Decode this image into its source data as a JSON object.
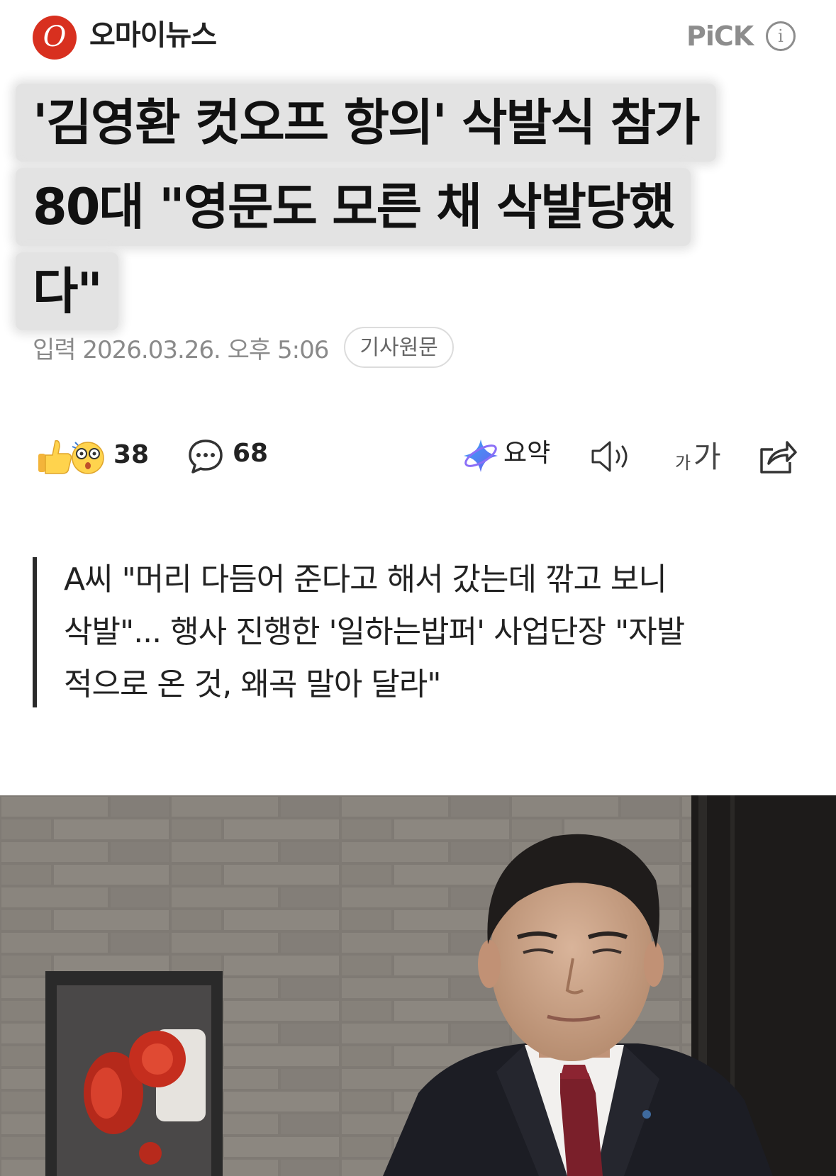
{
  "header": {
    "logo_letter": "O",
    "press_name": "오마이뉴스",
    "pick_label": "PiCK",
    "info_glyph": "i"
  },
  "headline": {
    "lines": [
      "'김영환 컷오프 항의' 삭발식 참가",
      "80대 \"영문도 모른 채 삭발당했",
      "다\""
    ]
  },
  "meta": {
    "date": "입력 2026.03.26. 오후 5:06",
    "original_link": "기사원문"
  },
  "toolbar": {
    "reaction_count": "38",
    "comment_count": "68",
    "summary_label": "요약",
    "font_small": "가",
    "font_big": "가",
    "icons": {
      "reactions": "thumbs-up-and-surprised-face-icons",
      "comment": "speech-bubble-icon",
      "summary": "sparkle-icon",
      "speaker": "speaker-icon",
      "share": "share-icon"
    }
  },
  "subtitle": {
    "lines": [
      "A씨 \"머리 다듬어 준다고 해서 갔는데 깎고 보니",
      "삭발\"... 행사 진행한 '일하는밥퍼' 사업단장 \"자발",
      "적으로 온 것, 왜곡 말아 달라\""
    ]
  },
  "colors": {
    "logo_red": "#d8301f",
    "headline_highlight": "#e3e3e3",
    "meta_gray": "#8a8a8a",
    "summary_purple": "#6a5cf0",
    "summary_blue": "#3aa7f5"
  }
}
